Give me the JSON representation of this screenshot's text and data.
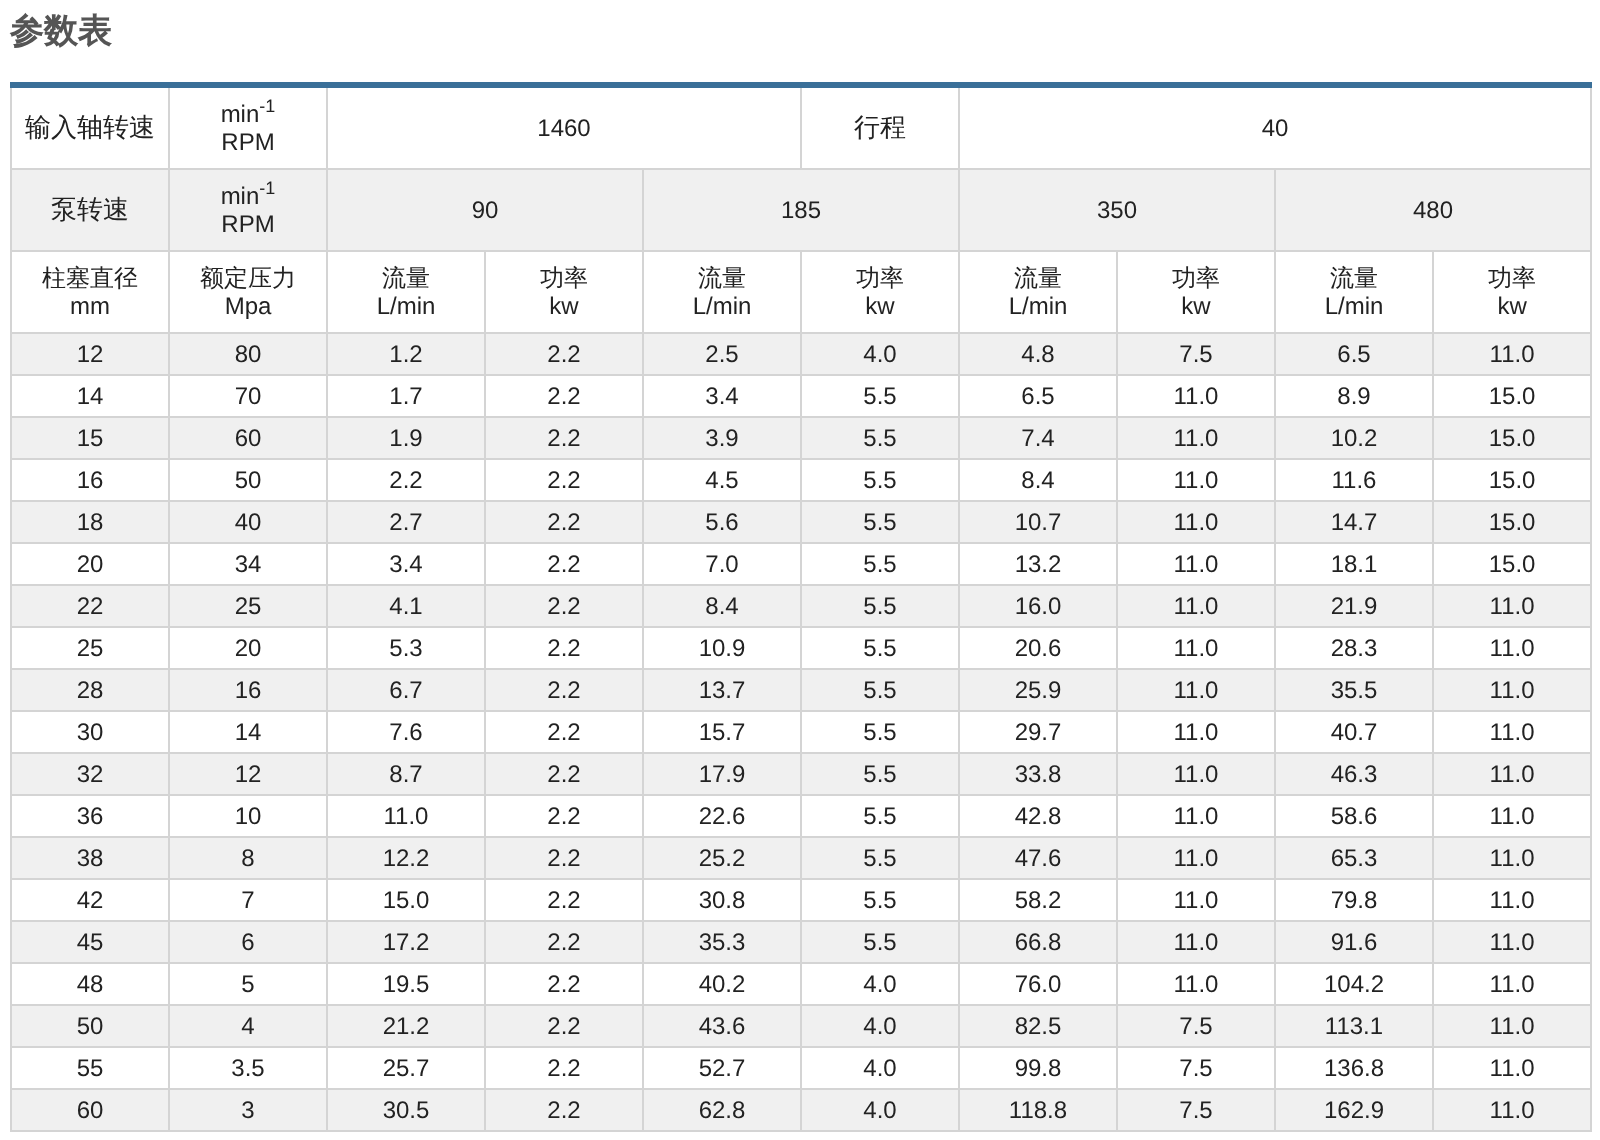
{
  "title": "参数表",
  "input_shaft": {
    "label": "输入轴转速",
    "unit": [
      "min$^{-1}$",
      "RPM"
    ],
    "value": "1460"
  },
  "stroke": {
    "label": "行程",
    "value": "40"
  },
  "pump_speed": {
    "label": "泵转速",
    "unit": [
      "min$^{-1}$",
      "RPM"
    ],
    "speeds": [
      "90",
      "185",
      "350",
      "480"
    ]
  },
  "columns": [
    {
      "name": "柱塞直径",
      "unit": "mm"
    },
    {
      "name": "额定压力",
      "unit": "Mpa"
    },
    {
      "name": "流量",
      "unit": "L/min"
    },
    {
      "name": "功率",
      "unit": "kw"
    },
    {
      "name": "流量",
      "unit": "L/min"
    },
    {
      "name": "功率",
      "unit": "kw"
    },
    {
      "name": "流量",
      "unit": "L/min"
    },
    {
      "name": "功率",
      "unit": "kw"
    },
    {
      "name": "流量",
      "unit": "L/min"
    },
    {
      "name": "功率",
      "unit": "kw"
    }
  ],
  "rows": [
    [
      "12",
      "80",
      "1.2",
      "2.2",
      "2.5",
      "4.0",
      "4.8",
      "7.5",
      "6.5",
      "11.0"
    ],
    [
      "14",
      "70",
      "1.7",
      "2.2",
      "3.4",
      "5.5",
      "6.5",
      "11.0",
      "8.9",
      "15.0"
    ],
    [
      "15",
      "60",
      "1.9",
      "2.2",
      "3.9",
      "5.5",
      "7.4",
      "11.0",
      "10.2",
      "15.0"
    ],
    [
      "16",
      "50",
      "2.2",
      "2.2",
      "4.5",
      "5.5",
      "8.4",
      "11.0",
      "11.6",
      "15.0"
    ],
    [
      "18",
      "40",
      "2.7",
      "2.2",
      "5.6",
      "5.5",
      "10.7",
      "11.0",
      "14.7",
      "15.0"
    ],
    [
      "20",
      "34",
      "3.4",
      "2.2",
      "7.0",
      "5.5",
      "13.2",
      "11.0",
      "18.1",
      "15.0"
    ],
    [
      "22",
      "25",
      "4.1",
      "2.2",
      "8.4",
      "5.5",
      "16.0",
      "11.0",
      "21.9",
      "11.0"
    ],
    [
      "25",
      "20",
      "5.3",
      "2.2",
      "10.9",
      "5.5",
      "20.6",
      "11.0",
      "28.3",
      "11.0"
    ],
    [
      "28",
      "16",
      "6.7",
      "2.2",
      "13.7",
      "5.5",
      "25.9",
      "11.0",
      "35.5",
      "11.0"
    ],
    [
      "30",
      "14",
      "7.6",
      "2.2",
      "15.7",
      "5.5",
      "29.7",
      "11.0",
      "40.7",
      "11.0"
    ],
    [
      "32",
      "12",
      "8.7",
      "2.2",
      "17.9",
      "5.5",
      "33.8",
      "11.0",
      "46.3",
      "11.0"
    ],
    [
      "36",
      "10",
      "11.0",
      "2.2",
      "22.6",
      "5.5",
      "42.8",
      "11.0",
      "58.6",
      "11.0"
    ],
    [
      "38",
      "8",
      "12.2",
      "2.2",
      "25.2",
      "5.5",
      "47.6",
      "11.0",
      "65.3",
      "11.0"
    ],
    [
      "42",
      "7",
      "15.0",
      "2.2",
      "30.8",
      "5.5",
      "58.2",
      "11.0",
      "79.8",
      "11.0"
    ],
    [
      "45",
      "6",
      "17.2",
      "2.2",
      "35.3",
      "5.5",
      "66.8",
      "11.0",
      "91.6",
      "11.0"
    ],
    [
      "48",
      "5",
      "19.5",
      "2.2",
      "40.2",
      "4.0",
      "76.0",
      "11.0",
      "104.2",
      "11.0"
    ],
    [
      "50",
      "4",
      "21.2",
      "2.2",
      "43.6",
      "4.0",
      "82.5",
      "7.5",
      "113.1",
      "11.0"
    ],
    [
      "55",
      "3.5",
      "25.7",
      "2.2",
      "52.7",
      "4.0",
      "99.8",
      "7.5",
      "136.8",
      "11.0"
    ],
    [
      "60",
      "3",
      "30.5",
      "2.2",
      "62.8",
      "4.0",
      "118.8",
      "7.5",
      "162.9",
      "11.0"
    ]
  ]
}
